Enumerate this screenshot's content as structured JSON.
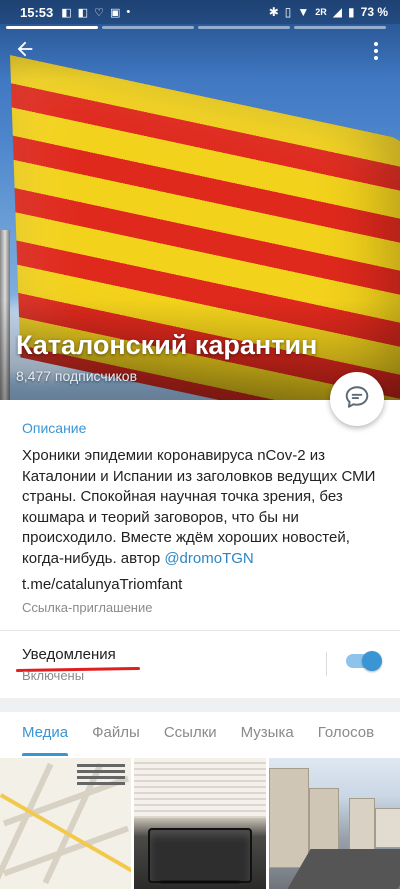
{
  "status_bar": {
    "time": "15:53",
    "battery": "73 %",
    "network": "2R"
  },
  "header": {
    "channel_title": "Каталонский карантин",
    "subscribers": "8,477 подписчиков",
    "back_icon": "arrow-left-icon",
    "menu_icon": "more-vertical-icon",
    "fab_icon": "chat-bubble-icon"
  },
  "info": {
    "description_label": "Описание",
    "description_text": "Хроники эпидемии коронавируса nCov-2 из Каталонии и Испании из заголовков ведущих СМИ страны. Спокойная научная точка зрения, без кошмара и теорий заговоров, что бы ни происходило. Вместе ждём хороших новостей, когда-нибудь. автор ",
    "description_mention": "@dromoTGN",
    "invite_link": "t.me/catalunyaTriomfant",
    "invite_link_label": "Ссылка-приглашение",
    "notifications_label": "Уведомления",
    "notifications_state": "Включены",
    "notifications_enabled": true
  },
  "tabs": [
    {
      "label": "Медиа",
      "active": true
    },
    {
      "label": "Файлы",
      "active": false
    },
    {
      "label": "Ссылки",
      "active": false
    },
    {
      "label": "Музыка",
      "active": false
    },
    {
      "label": "Голосов",
      "active": false
    }
  ],
  "colors": {
    "accent": "#3a95d5",
    "flag_yellow": "#f3d21c",
    "flag_red": "#e0291d",
    "annotation_red": "#e02020"
  }
}
